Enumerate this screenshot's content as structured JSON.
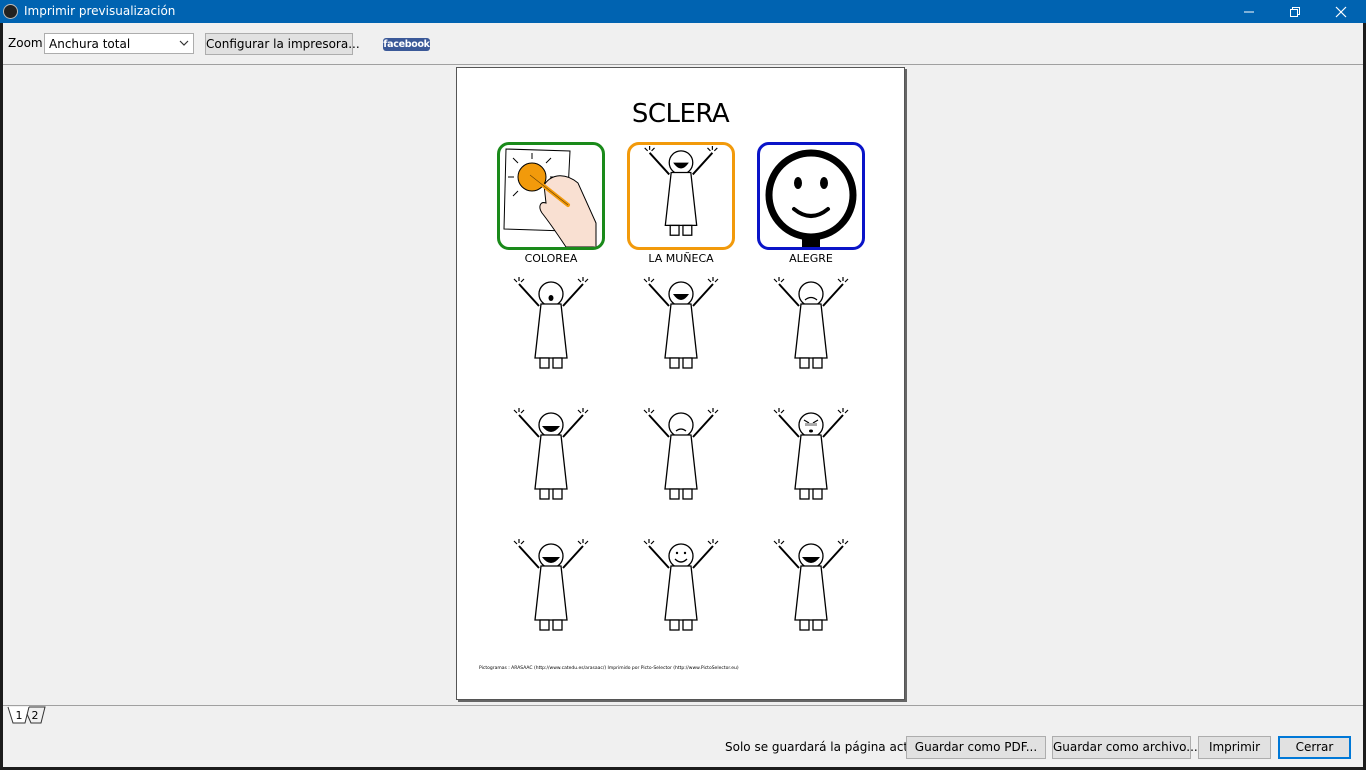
{
  "window": {
    "title": "Imprimir previsualización",
    "controls": [
      "minimize-icon",
      "restore-icon",
      "close-icon"
    ]
  },
  "toolbar": {
    "zoom_label": "Zoom",
    "zoom_value": "Anchura total",
    "configure_printer_label": "Configurar la impresora...",
    "facebook_label": "facebook"
  },
  "page": {
    "title": "SCLERA",
    "pictograms": [
      {
        "label": "COLOREA",
        "border_color": "#1a8a1a",
        "icon": "coloring-hand-icon"
      },
      {
        "label": "LA MUÑECA",
        "border_color": "#f29a0b",
        "icon": "doll-icon"
      },
      {
        "label": "ALEGRE",
        "border_color": "#0a14c8",
        "icon": "happy-face-icon"
      }
    ],
    "doll_grid": [
      [
        "doll-surprised-icon",
        "doll-happy-icon",
        "doll-sad-icon"
      ],
      [
        "doll-laughing-icon",
        "doll-worried-icon",
        "doll-angry-icon"
      ],
      [
        "doll-laughing-icon",
        "doll-smiling-icon",
        "doll-laughing-icon"
      ]
    ],
    "footer": "Pictogramas : ARASAAC (http://www.catedu.es/arasaac/) Imprimido por Picto-Selector (http://www.PictoSelector.eu)"
  },
  "page_tabs": [
    "1",
    "2"
  ],
  "bottom": {
    "note": "Solo se guardará la página actual",
    "save_pdf_label": "Guardar como PDF...",
    "save_file_label": "Guardar como archivo...",
    "print_label": "Imprimir",
    "close_label": "Cerrar"
  },
  "colors": {
    "titlebar": "#0063b1",
    "colorea_border": "#1a8a1a",
    "muneca_border": "#f29a0b",
    "alegre_border": "#0a14c8",
    "facebook": "#3b5998",
    "default_button_border": "#0078d7"
  }
}
